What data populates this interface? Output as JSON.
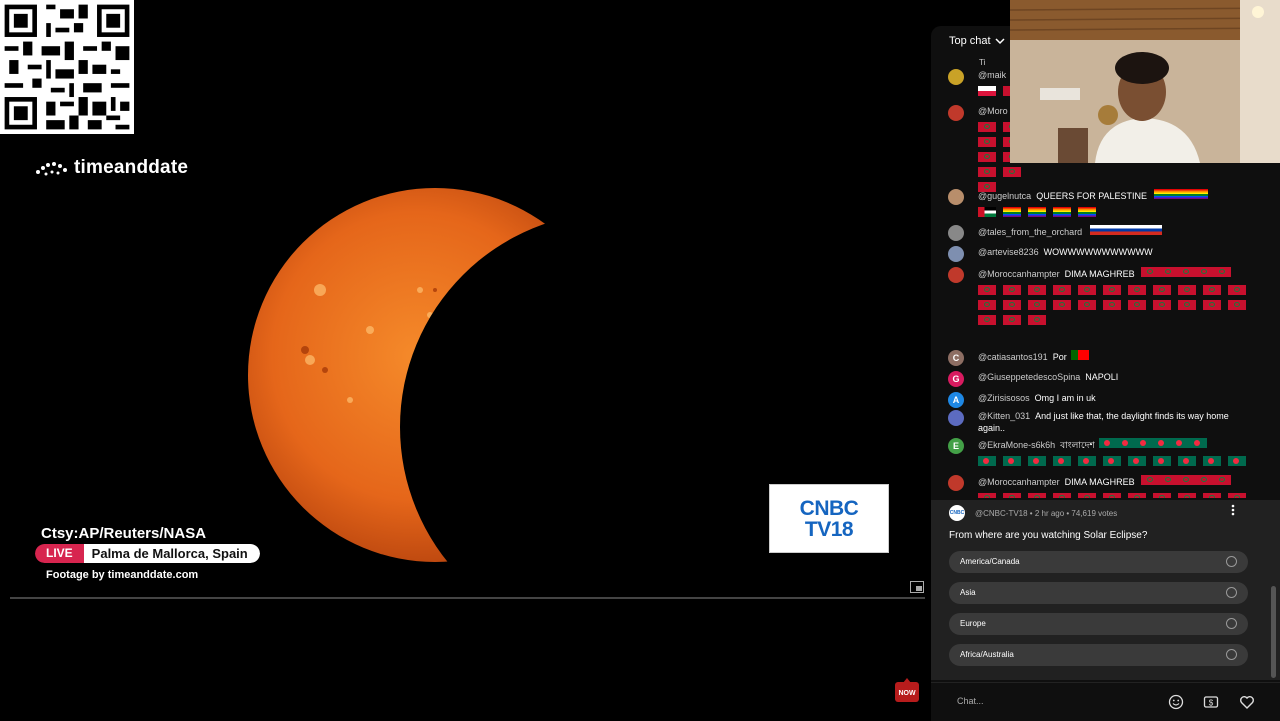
{
  "video": {
    "brand": "timeanddate",
    "credit": "Ctsy:AP/Reuters/NASA",
    "live_badge": "LIVE",
    "location": "Palma de Mallorca, Spain",
    "footage": "Footage by timeanddate.com",
    "logo_line1": "CNBC",
    "logo_line2": "TV18",
    "logo_color": "#1565c0",
    "live_color": "#d7254f",
    "sun_color": "#e5661a"
  },
  "chat": {
    "mode": "Top chat",
    "messages": [
      {
        "author": "@maik",
        "text": "",
        "avatar_letter": "",
        "avatar_color": "#c9a227"
      },
      {
        "author": "@Moro",
        "text": "",
        "avatar_letter": "",
        "avatar_color": "#c0392b"
      },
      {
        "author": "@gugelnutca",
        "text": "QUEERS FOR PALESTINE",
        "avatar_letter": "",
        "avatar_color": "#b88e6b"
      },
      {
        "author": "@tales_from_the_orchard",
        "text": "",
        "avatar_letter": "",
        "avatar_color": "#888888"
      },
      {
        "author": "@artevise8236",
        "text": "WOWWWWWWWWWWW",
        "avatar_letter": "",
        "avatar_color": "#7e8fb0"
      },
      {
        "author": "@Moroccanhampter",
        "text": "DIMA MAGHREB",
        "avatar_letter": "",
        "avatar_color": "#c0392b"
      },
      {
        "author": "@catiasantos191",
        "text": "Por",
        "avatar_letter": "C",
        "avatar_color": "#8d6e63"
      },
      {
        "author": "@GiuseppetedescoSpina",
        "text": "NAPOLI",
        "avatar_letter": "G",
        "avatar_color": "#d81b60"
      },
      {
        "author": "@Zirisisosos",
        "text": "Omg I am in uk",
        "avatar_letter": "A",
        "avatar_color": "#1e88e5"
      },
      {
        "author": "@Kitten_031",
        "text": "And just like that, the daylight finds its way home again..",
        "avatar_letter": "",
        "avatar_color": "#5c6bc0"
      },
      {
        "author": "@EkraMone-s6k6h",
        "text": "বাংলাদেশ",
        "avatar_letter": "E",
        "avatar_color": "#43a047"
      },
      {
        "author": "@Moroccanhampter",
        "text": "DIMA MAGHREB",
        "avatar_letter": "",
        "avatar_color": "#c0392b"
      }
    ],
    "poll": {
      "author": "@CNBC-TV18",
      "meta": "@CNBC-TV18 • 2 hr ago • 74,619 votes",
      "avatar_text": "CNBC",
      "question": "From where are you watching Solar Eclipse?",
      "options": [
        "America/Canada",
        "Asia",
        "Europe",
        "Africa/Australia"
      ]
    },
    "input_placeholder": "Chat...",
    "partial_text": "Ti"
  },
  "icons": [
    "qr-code-icon",
    "timeanddate-logo-icon",
    "chevron-down-icon",
    "more-vert-icon",
    "emoji-icon",
    "super-chat-icon",
    "heart-icon",
    "pip-icon",
    "now-icon"
  ]
}
